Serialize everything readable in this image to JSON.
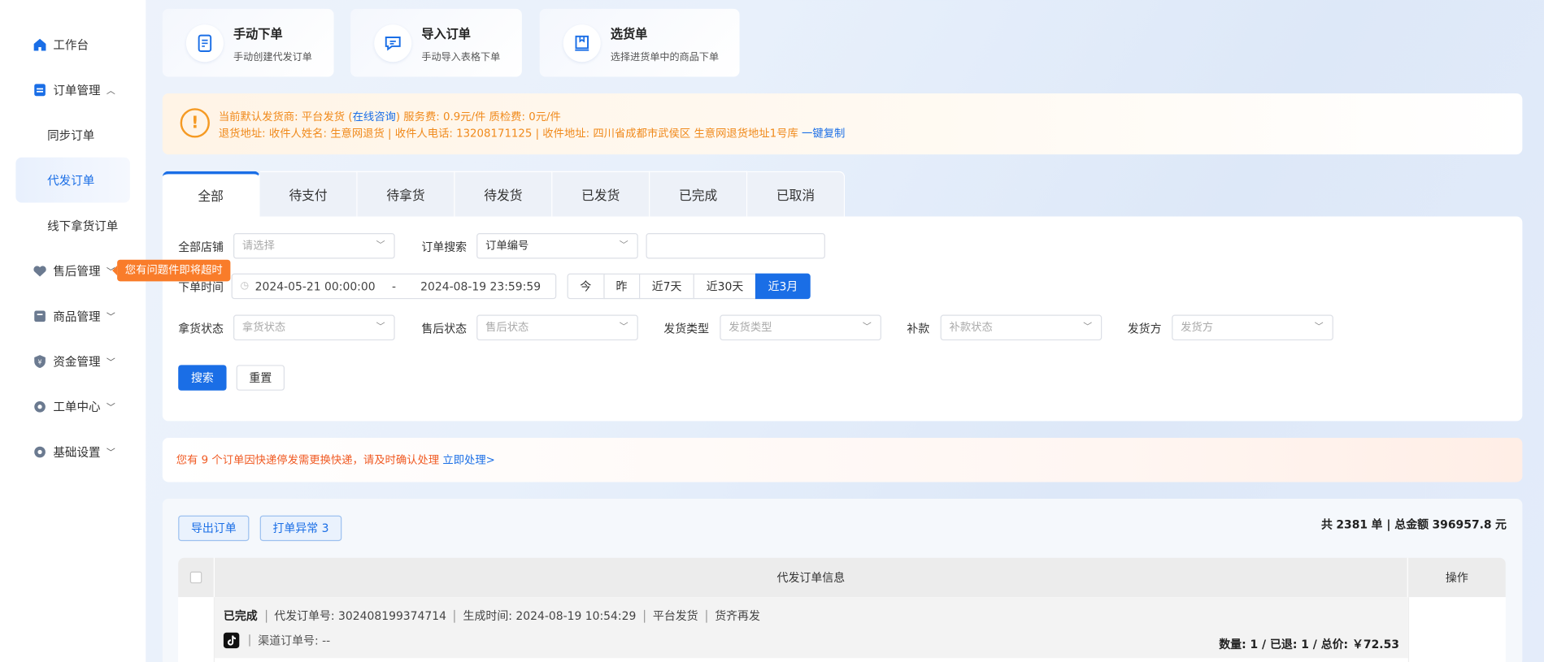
{
  "sidebar": {
    "items": [
      {
        "label": "工作台",
        "icon": "home-icon"
      },
      {
        "label": "订单管理",
        "icon": "order-icon",
        "expanded": true
      },
      {
        "label": "售后管理",
        "icon": "after-sale-icon"
      },
      {
        "label": "商品管理",
        "icon": "product-icon"
      },
      {
        "label": "资金管理",
        "icon": "shield-icon"
      },
      {
        "label": "工单中心",
        "icon": "gear-icon"
      },
      {
        "label": "基础设置",
        "icon": "settings-icon"
      }
    ],
    "sub_items": [
      {
        "label": "同步订单"
      },
      {
        "label": "代发订单",
        "active": true
      },
      {
        "label": "线下拿货订单"
      }
    ],
    "tooltip": "您有问题件即将超时"
  },
  "quick_cards": [
    {
      "title": "手动下单",
      "subtitle": "手动创建代发订单",
      "icon": "document-icon"
    },
    {
      "title": "导入订单",
      "subtitle": "手动导入表格下单",
      "icon": "import-icon"
    },
    {
      "title": "选货单",
      "subtitle": "选择进货单中的商品下单",
      "icon": "cart-icon"
    }
  ],
  "notice": {
    "line1_prefix": "当前默认发货商:  平台发货  (",
    "line1_link": "在线咨询",
    "line1_suffix": ")  服务费: 0.9元/件  质检费: 0元/件",
    "line2": "退货地址: 收件人姓名: 生意网退货 | 收件人电话: 13208171125 | 收件地址: 四川省成都市武侯区 生意网退货地址1号库",
    "line2_link": "一键复制"
  },
  "tabs": [
    {
      "label": "全部",
      "active": true
    },
    {
      "label": "待支付"
    },
    {
      "label": "待拿货"
    },
    {
      "label": "待发货"
    },
    {
      "label": "已发货"
    },
    {
      "label": "已完成"
    },
    {
      "label": "已取消"
    }
  ],
  "filters": {
    "store_label": "全部店铺",
    "store_placeholder": "请选择",
    "search_label": "订单搜索",
    "search_type": "订单编号",
    "search_value": "",
    "time_label": "下单时间",
    "date_start": "2024-05-21 00:00:00",
    "date_sep": "-",
    "date_end": "2024-08-19 23:59:59",
    "quick_ranges": [
      {
        "label": "今"
      },
      {
        "label": "昨"
      },
      {
        "label": "近7天"
      },
      {
        "label": "近30天"
      },
      {
        "label": "近3月",
        "active": true
      }
    ],
    "pickup_label": "拿货状态",
    "pickup_placeholder": "拿货状态",
    "aftersale_label": "售后状态",
    "aftersale_placeholder": "售后状态",
    "ship_type_label": "发货类型",
    "ship_type_placeholder": "发货类型",
    "refund_label": "补款",
    "refund_placeholder": "补款状态",
    "shipper_label": "发货方",
    "shipper_placeholder": "发货方",
    "search_button": "搜索",
    "reset_button": "重置"
  },
  "alert": {
    "text": "您有 9 个订单因快递停发需更换快递，请及时确认处理",
    "link": "立即处理>"
  },
  "list": {
    "export_button": "导出订单",
    "exception_button": "打单异常 3",
    "total_prefix": "共",
    "total_orders": "2381",
    "total_mid": "单 | 总金额",
    "total_amount": "396957.8",
    "total_suffix": "元",
    "header_info": "代发订单信息",
    "header_op": "操作",
    "rows": [
      {
        "status": "已完成",
        "order_no": "代发订单号: 302408199374714",
        "created": "生成时间: 2024-08-19 10:54:29",
        "shipper": "平台发货",
        "tag": "货齐再发",
        "channel_no": "渠道订单号: --",
        "summary": "数量: 1 / 已退: 1 / 总价: ￥72.53"
      }
    ]
  },
  "colors": {
    "primary": "#1a6ee6",
    "warning": "#f08a1c",
    "alert": "#f05a23",
    "tooltip": "#f97c2a"
  }
}
